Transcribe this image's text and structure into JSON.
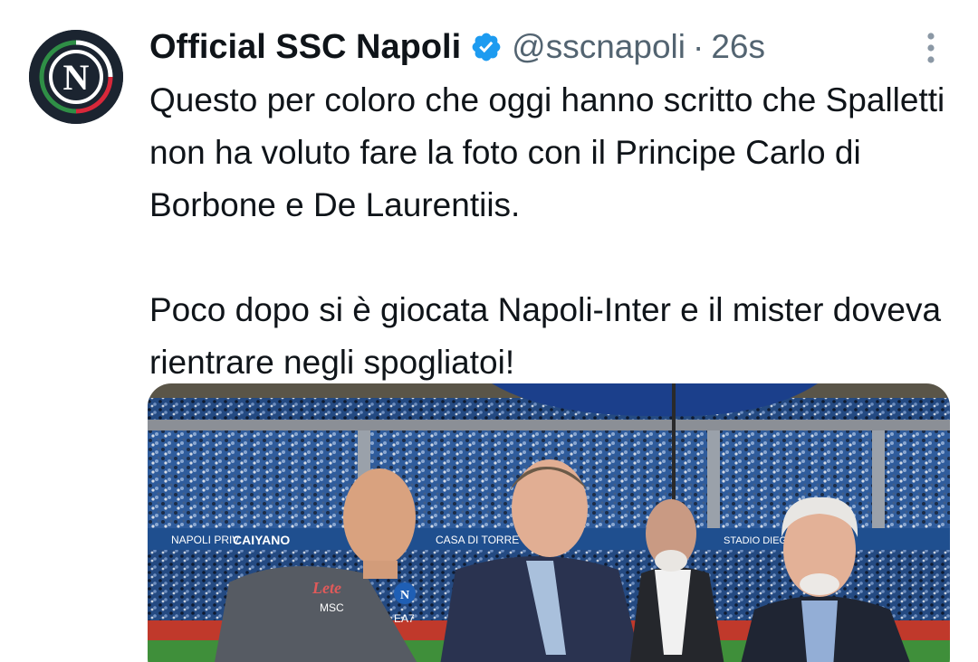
{
  "account": {
    "display_name": "Official SSC Napoli",
    "handle": "@sscnapoli",
    "separator": "·",
    "timestamp": "26s",
    "verified": true,
    "avatar_letter": "N",
    "verified_icon": "verified-badge-icon",
    "more_icon": "more-vertical-icon"
  },
  "tweet": {
    "paragraphs": [
      "Questo per coloro che oggi hanno scritto che Spalletti non ha voluto fare la foto con il Principe Carlo di Borbone e De Laurentiis.",
      "Poco dopo si è giocata Napoli-Inter e il mister doveva rientrare negli spogliatoi!"
    ]
  },
  "media": {
    "ad_boards": [
      "NAPOLI PRIV",
      "CAIYANO",
      "CASA DI TORRE",
      "STADIO DIEGO"
    ],
    "jacket_text": [
      "Lete",
      "MSC",
      "EA7"
    ],
    "crest_letter": "N"
  },
  "colors": {
    "accent_blue": "#1d9bf0",
    "text_primary": "#0f1419",
    "text_secondary": "#536471",
    "napoli_navy": "#1b2430",
    "stadium_blue": "#2b5ea8"
  }
}
